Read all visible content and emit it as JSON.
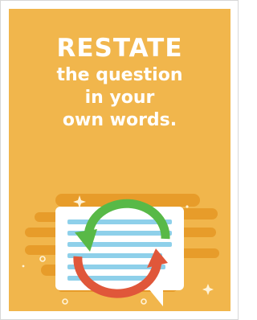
{
  "poster": {
    "headline": "RESTATE",
    "lines": [
      "the question",
      "in your",
      "own words."
    ],
    "colors": {
      "background": "#f1b64c",
      "stripes": "#e79c2a",
      "card": "#ffffff",
      "card_lines": "#8ed0ea",
      "arrow_green": "#58b947",
      "arrow_red": "#e0573a"
    },
    "icon": "restate-chat-arrows-icon"
  }
}
